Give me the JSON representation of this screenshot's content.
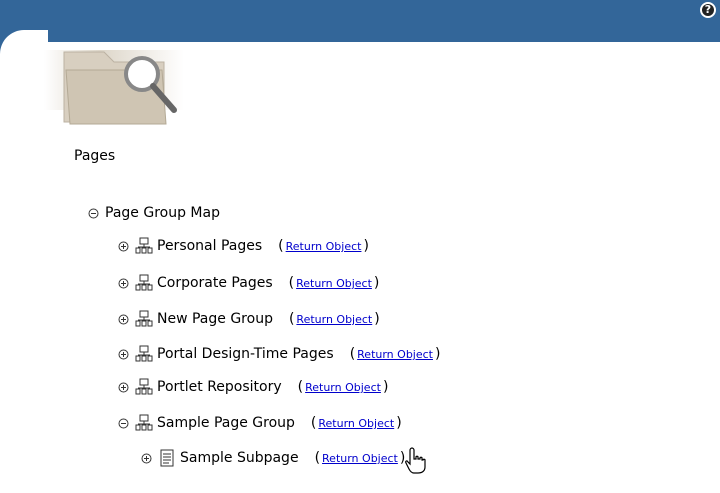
{
  "window": {
    "help_label": "?"
  },
  "section": {
    "title": "Pages"
  },
  "tree": {
    "root_label": "Page Group Map",
    "return_link": "Return Object",
    "items": [
      {
        "label": "Personal Pages",
        "expanded": false
      },
      {
        "label": "Corporate Pages",
        "expanded": false
      },
      {
        "label": "New Page Group",
        "expanded": false
      },
      {
        "label": "Portal Design-Time Pages",
        "expanded": false
      },
      {
        "label": "Portlet Repository",
        "expanded": false
      },
      {
        "label": "Sample Page Group",
        "expanded": true
      }
    ],
    "subitem": {
      "label": "Sample Subpage",
      "expanded": false
    }
  },
  "colors": {
    "banner": "#336699",
    "link": "#0000cc"
  },
  "icons": {
    "help": "help-icon",
    "group": "page-group-icon",
    "page": "page-icon"
  }
}
